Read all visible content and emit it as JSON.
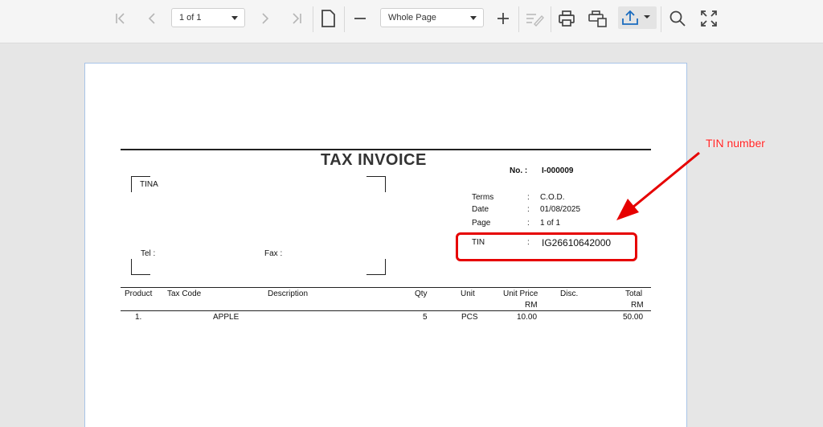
{
  "toolbar": {
    "page_select": "1 of 1",
    "zoom_select": "Whole Page",
    "icons": [
      "first-page-icon",
      "prev-page-icon",
      "next-page-icon",
      "last-page-icon",
      "single-page-icon",
      "zoom-out-icon",
      "zoom-in-icon",
      "edit-icon",
      "print-icon",
      "print-page-icon",
      "export-icon",
      "search-icon",
      "fullscreen-icon"
    ]
  },
  "invoice": {
    "title": "TAX INVOICE",
    "no_label": "No.  :",
    "no_value": "I-000009",
    "customer_name": "TINA",
    "tel_label": "Tel  :",
    "fax_label": "Fax  :",
    "meta": [
      {
        "label": "Terms",
        "sep": ":",
        "value": "C.O.D."
      },
      {
        "label": "Date",
        "sep": ":",
        "value": "01/08/2025"
      },
      {
        "label": "Page",
        "sep": ":",
        "value": "1 of 1"
      }
    ],
    "tin_label": "TIN",
    "tin_sep": ":",
    "tin_value": "IG26610642000",
    "columns": {
      "product": "Product",
      "tax_code": "Tax Code",
      "description": "Description",
      "qty": "Qty",
      "unit": "Unit",
      "unit_price": "Unit Price",
      "unit_price_cur": "RM",
      "disc": "Disc.",
      "total": "Total",
      "total_cur": "RM"
    },
    "rows": [
      {
        "no": "1.",
        "description": "APPLE",
        "qty": "5",
        "unit": "PCS",
        "unit_price": "10.00",
        "total": "50.00"
      }
    ]
  },
  "annotation": {
    "label": "TIN number",
    "color": "#e60000"
  }
}
